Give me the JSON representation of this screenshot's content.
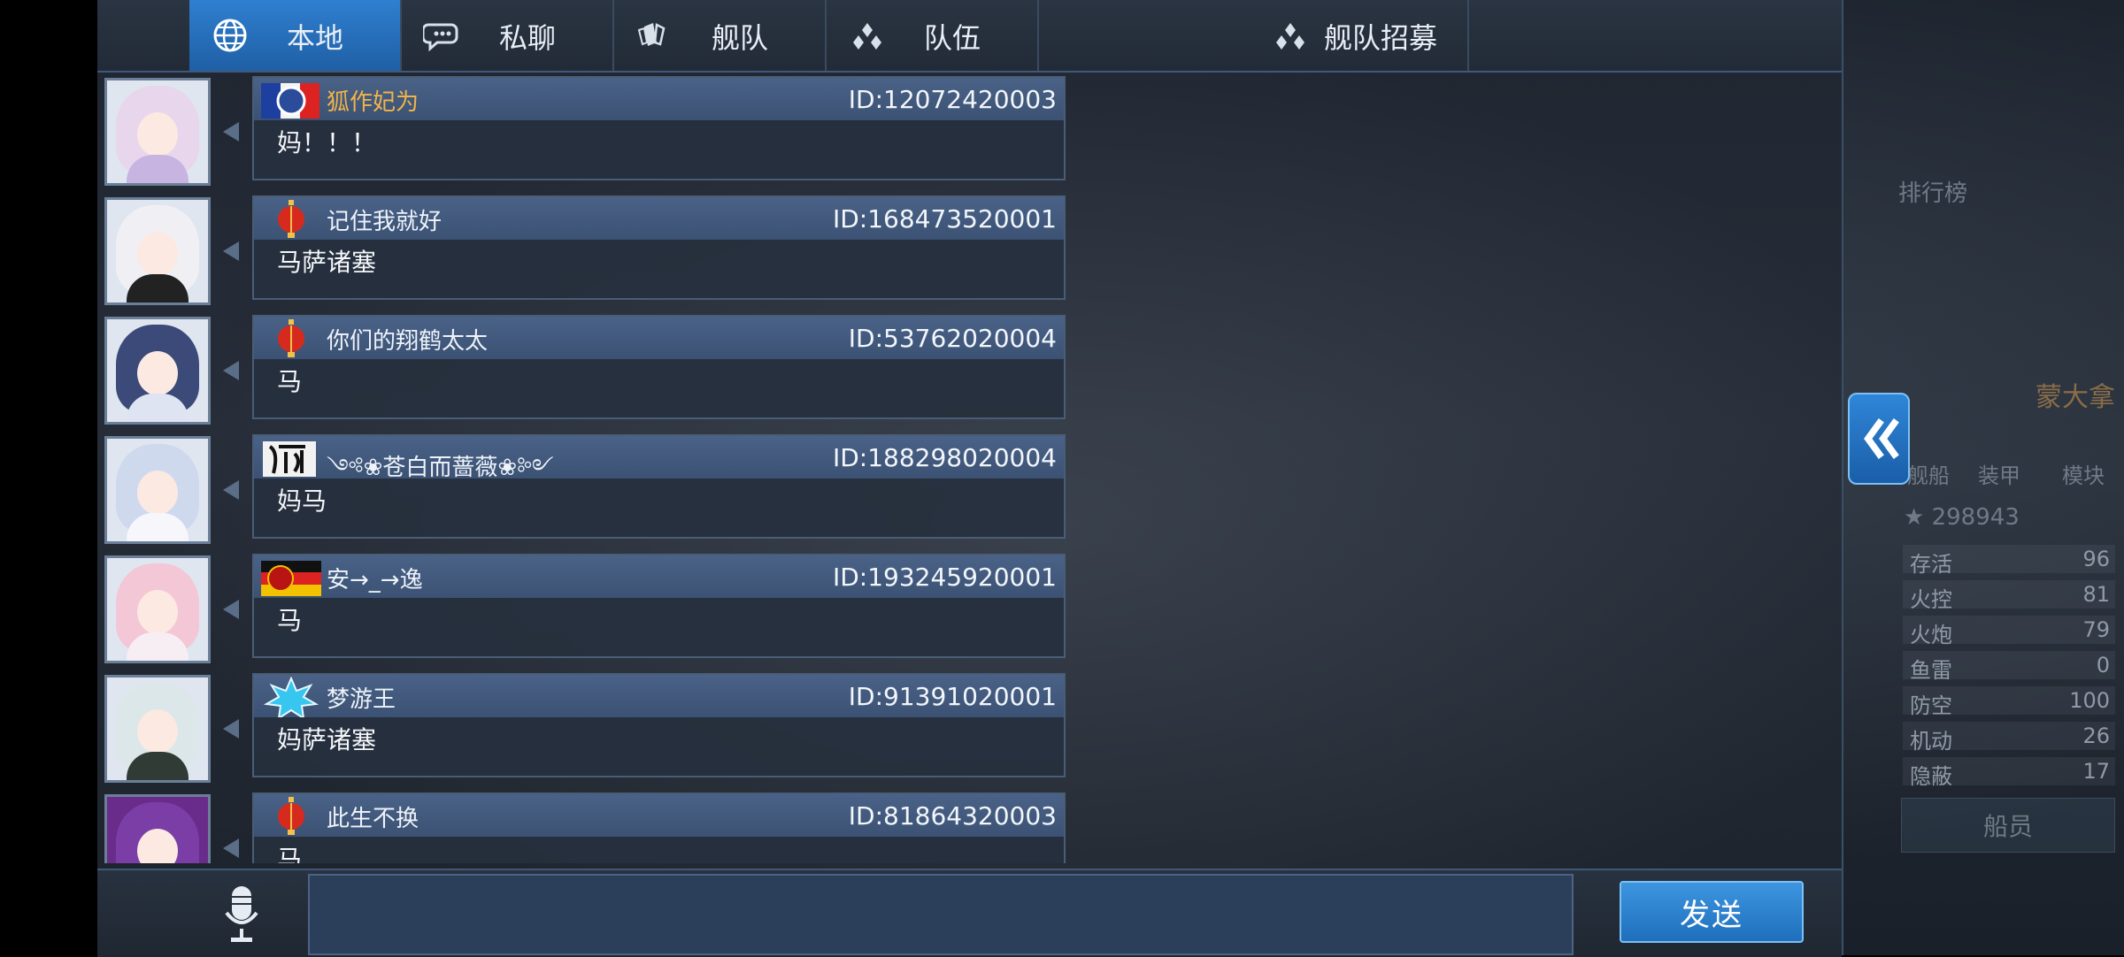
{
  "tabs": [
    {
      "label": "本地",
      "icon": "globe-icon",
      "active": true
    },
    {
      "label": "私聊",
      "icon": "chat-bubble-icon",
      "active": false
    },
    {
      "label": "舰队",
      "icon": "fleet-icon",
      "active": false
    },
    {
      "label": "队伍",
      "icon": "team-icon",
      "active": false
    },
    {
      "label": "舰队招募",
      "icon": "team-icon",
      "active": false
    }
  ],
  "messages": [
    {
      "name": "狐作妃为",
      "name_color": "#f0b34a",
      "id": "ID:12072420003",
      "text": "妈！！！",
      "badge": "french-flag-emblem"
    },
    {
      "name": "记住我就好",
      "id": "ID:168473520001",
      "text": "马萨诸塞",
      "badge": "red-lantern"
    },
    {
      "name": "你们的翔鹤太太",
      "id": "ID:53762020004",
      "text": "马",
      "badge": "red-lantern"
    },
    {
      "name": "༺❀苍白而蔷薇❀༻",
      "id": "ID:188298020004",
      "text": "妈马",
      "badge": "calligraphy-emblem"
    },
    {
      "name": "安→_→逸",
      "id": "ID:193245920001",
      "text": "马",
      "badge": "german-flag-emblem"
    },
    {
      "name": "梦游王",
      "id": "ID:91391020001",
      "text": "妈萨诸塞",
      "badge": "snowflake-emblem"
    },
    {
      "name": "此生不换",
      "id": "ID:81864320003",
      "text": "马",
      "badge": "red-lantern"
    }
  ],
  "input": {
    "placeholder": "",
    "value": ""
  },
  "send_label": "发送",
  "side": {
    "ranking_label": "排行榜",
    "ship_name": "蒙大拿",
    "tabs": [
      "舰船",
      "装甲",
      "模块"
    ],
    "power": "298943",
    "stats": [
      {
        "k": "存活",
        "v": "96"
      },
      {
        "k": "火控",
        "v": "81"
      },
      {
        "k": "火炮",
        "v": "79"
      },
      {
        "k": "鱼雷",
        "v": "0"
      },
      {
        "k": "防空",
        "v": "100"
      },
      {
        "k": "机动",
        "v": "26"
      },
      {
        "k": "隐蔽",
        "v": "17"
      }
    ],
    "crew_label": "船员"
  },
  "colors": {
    "accent": "#2f7fd0",
    "name_highlight": "#f0b34a"
  }
}
